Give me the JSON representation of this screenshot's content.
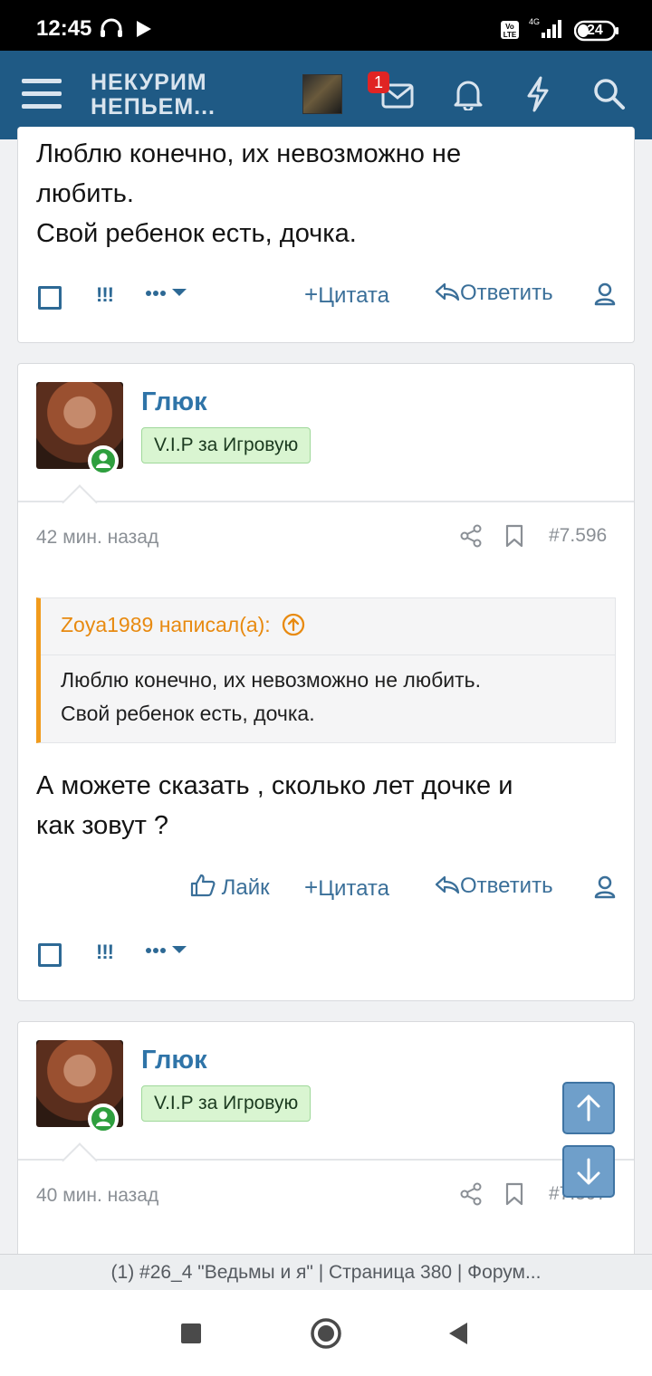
{
  "status_bar": {
    "time": "12:45",
    "battery": "24",
    "network": "4G"
  },
  "header": {
    "logo_line1": "НЕКУРИМ",
    "logo_line2": "НЕПЬЕМ...",
    "messages_badge": "1"
  },
  "post_top": {
    "text_line1": "Люблю конечно, их невозможно не",
    "text_line2": "любить.",
    "text_line3": "Свой ребенок есть, дочка.",
    "bang": "!!!",
    "quote_label": "Цитата",
    "reply_label": "Ответить"
  },
  "post_7596": {
    "username": "Глюк",
    "rank": "V.I.P за Игровую",
    "time": "42 мин. назад",
    "number": "#7.596",
    "quote_author": "Zoya1989 написал(а):",
    "quote_line1": "Люблю конечно, их невозможно не любить.",
    "quote_line2": "Свой ребенок есть, дочка.",
    "text_line1": "А можете сказать , сколько лет дочке и",
    "text_line2": "как зовут ?",
    "like_label": "Лайк",
    "quote_label": "Цитата",
    "reply_label": "Ответить",
    "bang": "!!!"
  },
  "post_7597": {
    "username": "Глюк",
    "rank": "V.I.P за Игровую",
    "time": "40 мин. назад",
    "number": "#7.597"
  },
  "bottom_title": "(1) #26_4 \"Ведьмы и я\" | Страница 380 | Форум...",
  "colors": {
    "header": "#1f5a85",
    "link": "#3a6f99",
    "quote_accent": "#f19b1c",
    "online": "#2e9f3e"
  }
}
